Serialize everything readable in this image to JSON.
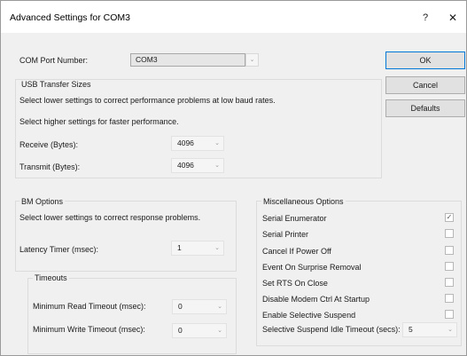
{
  "window": {
    "title": "Advanced Settings for COM3",
    "help_glyph": "?",
    "close_glyph": "✕"
  },
  "com_port": {
    "label": "COM Port Number:",
    "value": "COM3"
  },
  "usb": {
    "title": "USB Transfer Sizes",
    "line1": "Select lower settings to correct performance problems at low baud rates.",
    "line2": "Select higher settings for faster performance.",
    "receive_label": "Receive (Bytes):",
    "receive_value": "4096",
    "transmit_label": "Transmit (Bytes):",
    "transmit_value": "4096"
  },
  "bm": {
    "title": "BM Options",
    "line1": "Select lower settings to correct response problems.",
    "latency_label": "Latency Timer (msec):",
    "latency_value": "1"
  },
  "timeouts": {
    "title": "Timeouts",
    "read_label": "Minimum Read Timeout (msec):",
    "read_value": "0",
    "write_label": "Minimum Write Timeout (msec):",
    "write_value": "0"
  },
  "misc": {
    "title": "Miscellaneous Options",
    "items": [
      {
        "label": "Serial Enumerator",
        "checked": true
      },
      {
        "label": "Serial Printer",
        "checked": false
      },
      {
        "label": "Cancel If Power Off",
        "checked": false
      },
      {
        "label": "Event On Surprise Removal",
        "checked": false
      },
      {
        "label": "Set RTS On Close",
        "checked": false
      },
      {
        "label": "Disable Modem Ctrl At Startup",
        "checked": false
      },
      {
        "label": "Enable Selective Suspend",
        "checked": false
      }
    ],
    "suspend_label": "Selective Suspend Idle Timeout (secs):",
    "suspend_value": "5"
  },
  "buttons": {
    "ok": "OK",
    "cancel": "Cancel",
    "defaults": "Defaults"
  },
  "icons": {
    "dropdown_arrow": "chevron-down-icon",
    "check_mark": "✓"
  }
}
